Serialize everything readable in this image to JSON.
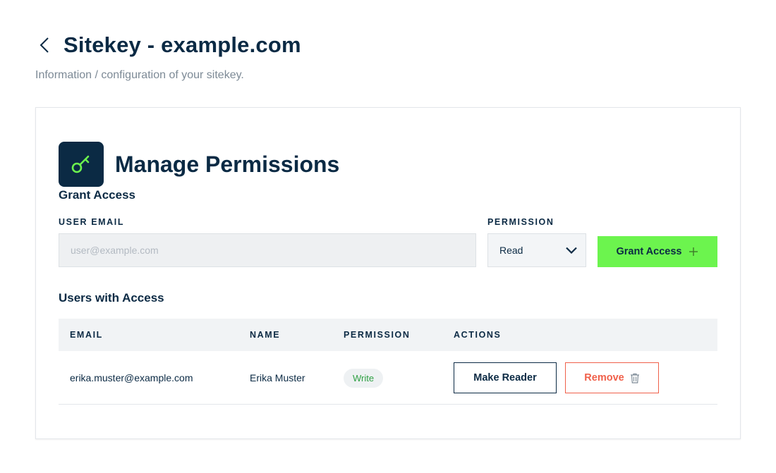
{
  "header": {
    "title": "Sitekey - example.com",
    "subtitle": "Information / configuration of your sitekey."
  },
  "card": {
    "title": "Manage Permissions",
    "grant": {
      "section_title": "Grant Access",
      "email_label": "USER EMAIL",
      "email_placeholder": "user@example.com",
      "email_value": "",
      "permission_label": "PERMISSION",
      "permission_selected": "Read",
      "button_label": "Grant Access"
    },
    "users": {
      "section_title": "Users with Access",
      "columns": [
        "EMAIL",
        "NAME",
        "PERMISSION",
        "ACTIONS"
      ],
      "rows": [
        {
          "email": "erika.muster@example.com",
          "name": "Erika Muster",
          "permission": "Write",
          "action_primary": "Make Reader",
          "action_remove": "Remove"
        }
      ]
    }
  },
  "colors": {
    "navy": "#0b2a44",
    "accent_green": "#6cf44e",
    "danger": "#f0604a",
    "badge_green": "#2ea043"
  },
  "icons": {
    "back": "chevron-left-icon",
    "key": "key-icon",
    "dropdown": "chevron-down-icon",
    "add": "plus-icon",
    "remove": "trash-icon"
  }
}
